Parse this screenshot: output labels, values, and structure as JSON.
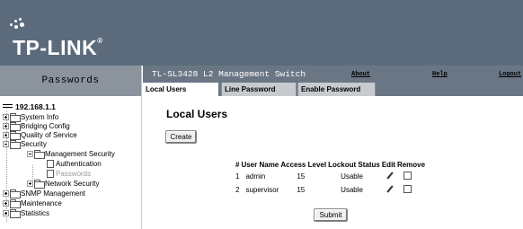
{
  "header": {
    "logo_text": "TP-LINK",
    "logo_reg": "®"
  },
  "left_title": "Passwords",
  "topbar": {
    "product": "TL-SL3428 L2 Management Switch",
    "about": "About",
    "help": "Help",
    "logout": "Logout"
  },
  "tabs": [
    {
      "label": "Local Users",
      "active": true
    },
    {
      "label": "Line Password",
      "active": false
    },
    {
      "label": "Enable Password",
      "active": false
    }
  ],
  "sidebar": {
    "root": "192.168.1.1",
    "items": [
      {
        "label": "System Info"
      },
      {
        "label": "Bridging Config"
      },
      {
        "label": "Quality of Service"
      },
      {
        "label": "Security"
      },
      {
        "label": "Management Security"
      },
      {
        "label": "Authentication"
      },
      {
        "label": "Passwords"
      },
      {
        "label": "Network Security"
      },
      {
        "label": "SNMP Management"
      },
      {
        "label": "Maintenance"
      },
      {
        "label": "Statistics"
      }
    ]
  },
  "main": {
    "title": "Local Users",
    "create_label": "Create",
    "submit_label": "Submit",
    "table": {
      "headers": [
        "#",
        "User Name",
        "Access Level",
        "Lockout Status",
        "Edit",
        "Remove"
      ],
      "rows": [
        {
          "num": "1",
          "user": "admin",
          "level": "15",
          "status": "Usable"
        },
        {
          "num": "2",
          "user": "supervisor",
          "level": "15",
          "status": "Usable"
        }
      ]
    }
  },
  "colors": {
    "banner": "#5b6b7c",
    "topbar": "#6b7684",
    "left_title_bg": "#8b939d",
    "inactive_tab": "#c7cbd0"
  },
  "icons": {
    "edit": "pencil-icon",
    "folder": "folder-icon",
    "page": "page-icon"
  }
}
